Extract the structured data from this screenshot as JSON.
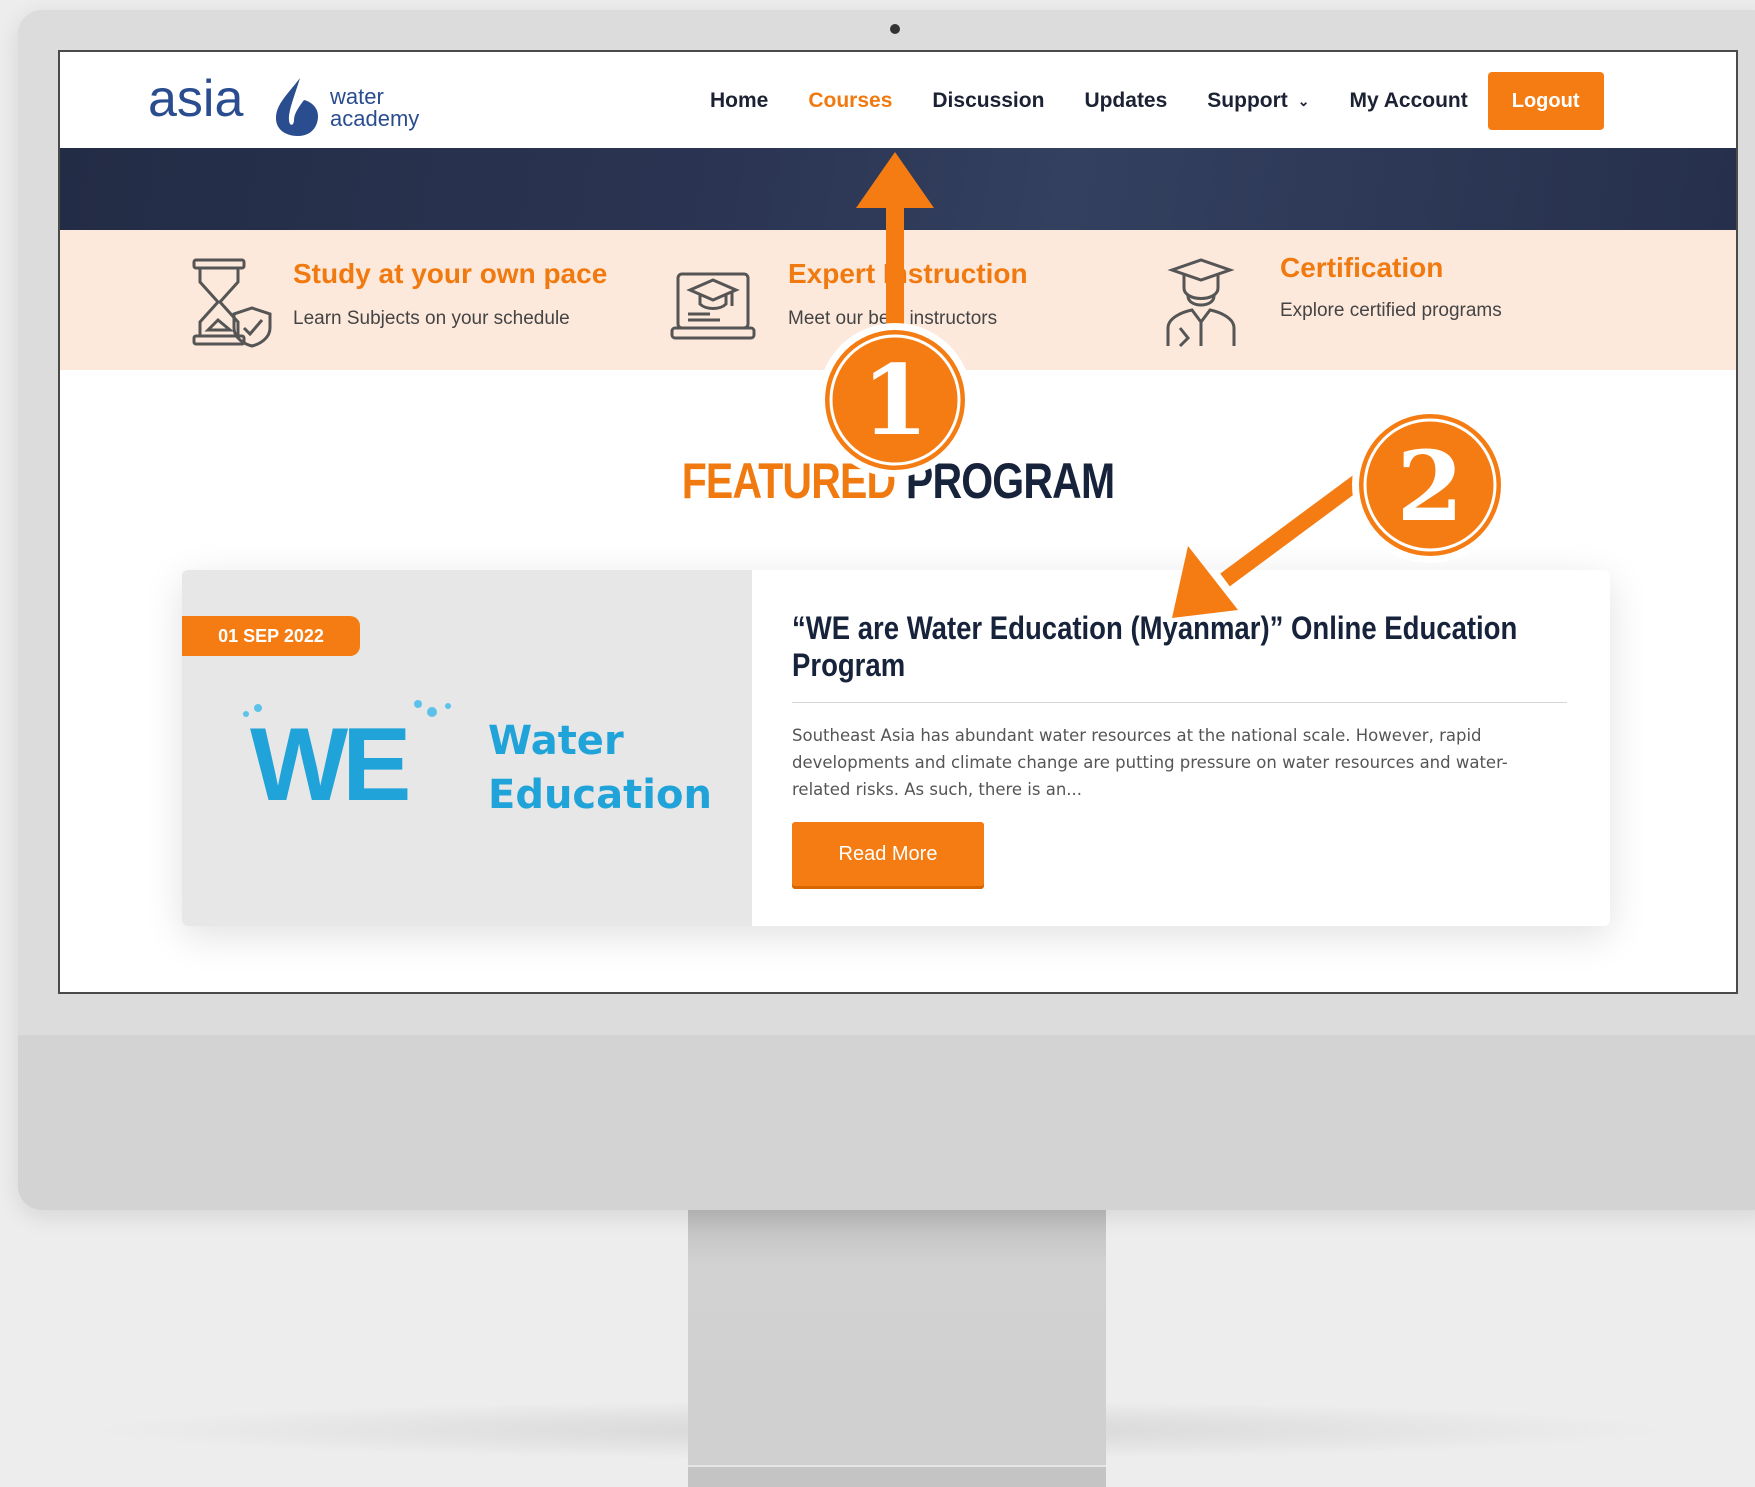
{
  "header": {
    "logo_main": "asia",
    "logo_line1": "water",
    "logo_line2": "academy",
    "nav": [
      {
        "label": "Home"
      },
      {
        "label": "Courses"
      },
      {
        "label": "Discussion"
      },
      {
        "label": "Updates"
      },
      {
        "label": "Support"
      },
      {
        "label": "My Account"
      }
    ],
    "logout_label": "Logout"
  },
  "features": [
    {
      "title": "Study at your own pace",
      "desc": "Learn Subjects on your schedule",
      "icon": "hourglass-shield-icon"
    },
    {
      "title": "Expert Instruction",
      "desc": "Meet our best instructors",
      "icon": "laptop-graduation-icon"
    },
    {
      "title": "Certification",
      "desc": "Explore certified programs",
      "icon": "graduate-person-icon"
    }
  ],
  "featured": {
    "heading_part1": "FEATURED",
    "heading_part2": "PROGRAM",
    "date": "01 SEP 2022",
    "logo_we": "WE",
    "logo_line1": "Water",
    "logo_line2": "Education",
    "title": "“WE are Water Education (Myanmar)” Online Education Program",
    "text": "Southeast Asia has abundant water resources at the national scale. However, rapid developments and climate change are putting pressure on water resources and water-related risks. As such, there is an...",
    "read_more": "Read More"
  },
  "annotations": [
    "1",
    "2"
  ],
  "colors": {
    "accent": "#f47c12",
    "navy": "#17223b",
    "feature_bg": "#fde9dc",
    "logo_blue": "#2a4d8f",
    "we_blue": "#1fa3d8"
  }
}
